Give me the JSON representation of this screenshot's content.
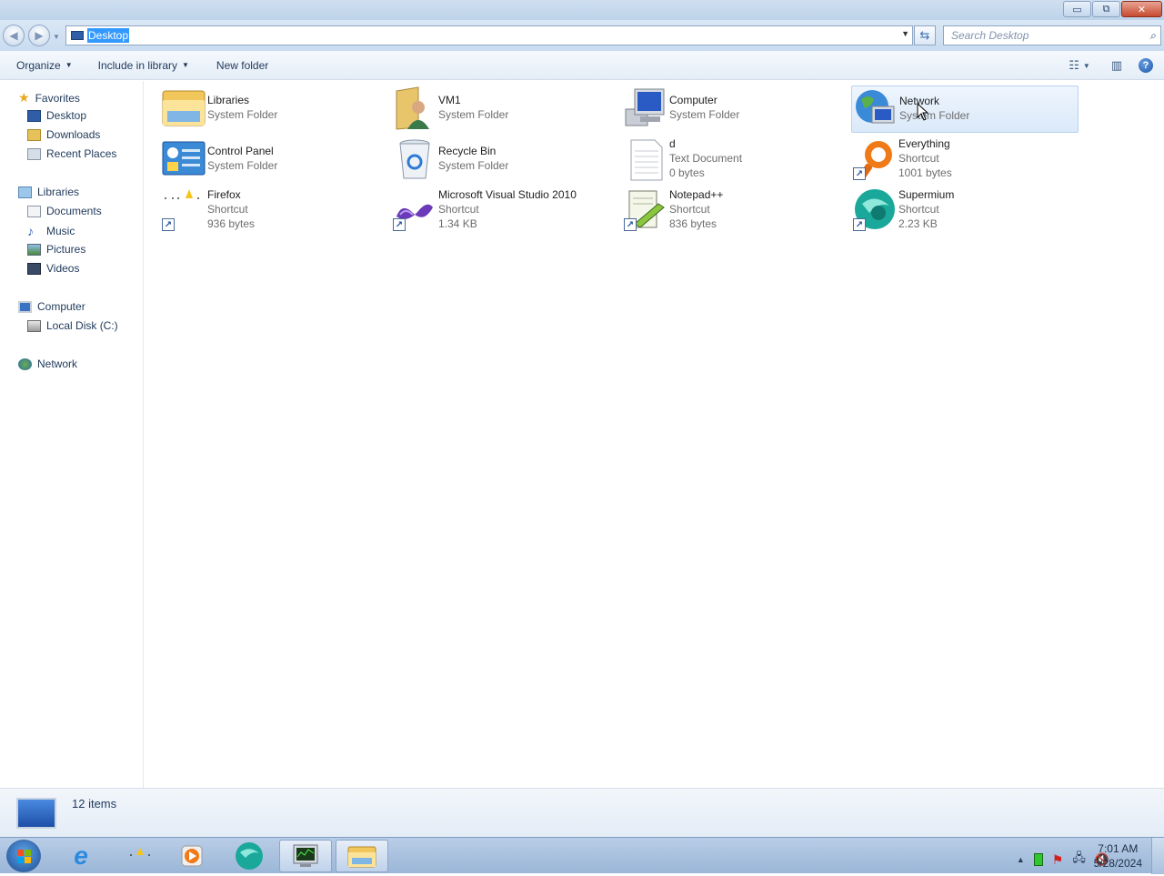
{
  "window": {
    "buttons": {
      "minimize": "▭",
      "maximize": "⧉",
      "close": "✕"
    }
  },
  "address": {
    "path": "Desktop",
    "search_placeholder": "Search Desktop"
  },
  "toolbar": {
    "organize": "Organize",
    "include_in_library": "Include in library",
    "new_folder": "New folder"
  },
  "nav": {
    "favorites": "Favorites",
    "desktop": "Desktop",
    "downloads": "Downloads",
    "recent_places": "Recent Places",
    "libraries": "Libraries",
    "documents": "Documents",
    "music": "Music",
    "pictures": "Pictures",
    "videos": "Videos",
    "computer": "Computer",
    "local_disk": "Local Disk (C:)",
    "network": "Network"
  },
  "items": [
    {
      "name": "Libraries",
      "l2": "System Folder",
      "l3": ""
    },
    {
      "name": "VM1",
      "l2": "System Folder",
      "l3": ""
    },
    {
      "name": "Computer",
      "l2": "System Folder",
      "l3": ""
    },
    {
      "name": "Network",
      "l2": "System Folder",
      "l3": ""
    },
    {
      "name": "Control Panel",
      "l2": "System Folder",
      "l3": ""
    },
    {
      "name": "Recycle Bin",
      "l2": "System Folder",
      "l3": ""
    },
    {
      "name": "d",
      "l2": "Text Document",
      "l3": "0 bytes"
    },
    {
      "name": "Everything",
      "l2": "Shortcut",
      "l3": "1001 bytes"
    },
    {
      "name": "Firefox",
      "l2": "Shortcut",
      "l3": "936 bytes"
    },
    {
      "name": "Microsoft Visual Studio 2010",
      "l2": "Shortcut",
      "l3": "1.34 KB"
    },
    {
      "name": "Notepad++",
      "l2": "Shortcut",
      "l3": "836 bytes"
    },
    {
      "name": "Supermium",
      "l2": "Shortcut",
      "l3": "2.23 KB"
    }
  ],
  "status": {
    "count": "12 items"
  },
  "clock": {
    "time": "7:01 AM",
    "date": "5/28/2024"
  }
}
